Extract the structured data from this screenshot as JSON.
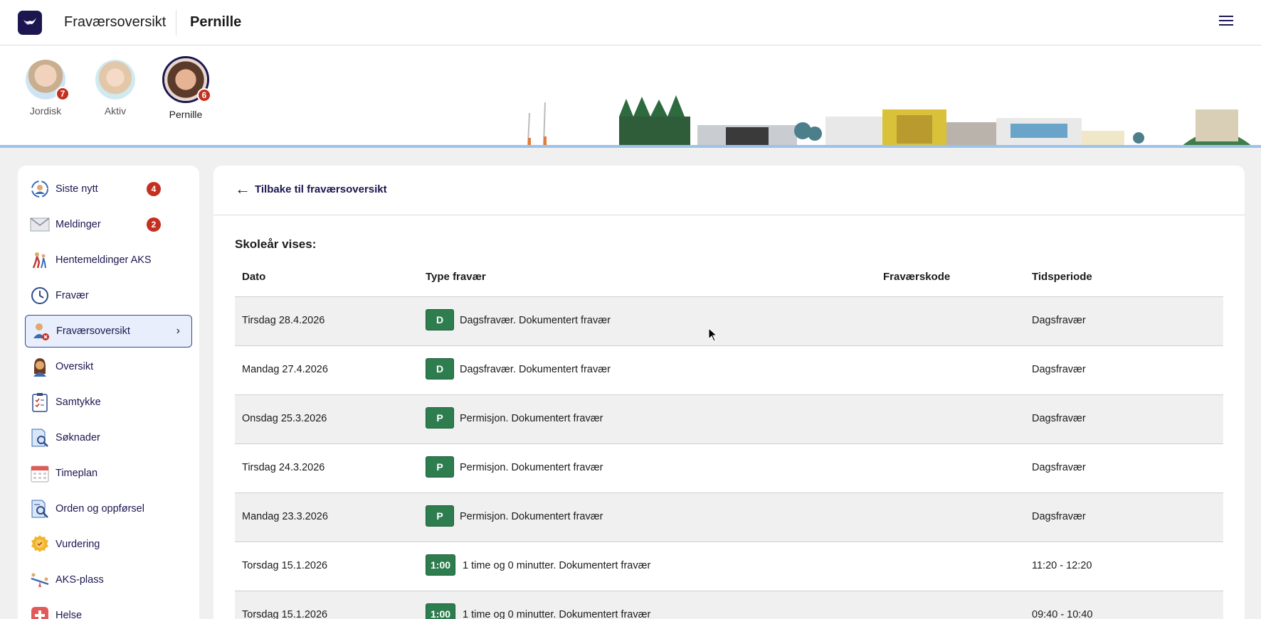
{
  "header": {
    "title": "Fraværsoversikt",
    "child_name": "Pernille"
  },
  "children": [
    {
      "name": "Jordisk",
      "badge": "7",
      "selected": false
    },
    {
      "name": "Aktiv",
      "badge": "",
      "selected": false
    },
    {
      "name": "Pernille",
      "badge": "6",
      "selected": true
    }
  ],
  "sidebar": {
    "items": [
      {
        "label": "Siste nytt",
        "count": "4",
        "icon": "news-icon"
      },
      {
        "label": "Meldinger",
        "count": "2",
        "icon": "envelope-icon"
      },
      {
        "label": "Hentemeldinger AKS",
        "count": "",
        "icon": "pickup-icon"
      },
      {
        "label": "Fravær",
        "count": "",
        "icon": "clock-icon"
      },
      {
        "label": "Fraværsoversikt",
        "count": "",
        "icon": "absence-overview-icon",
        "active": true
      },
      {
        "label": "Oversikt",
        "count": "",
        "icon": "overview-icon"
      },
      {
        "label": "Samtykke",
        "count": "",
        "icon": "clipboard-icon"
      },
      {
        "label": "Søknader",
        "count": "",
        "icon": "application-search-icon"
      },
      {
        "label": "Timeplan",
        "count": "",
        "icon": "calendar-icon"
      },
      {
        "label": "Orden og oppførsel",
        "count": "",
        "icon": "conduct-icon"
      },
      {
        "label": "Vurdering",
        "count": "",
        "icon": "medal-icon"
      },
      {
        "label": "AKS-plass",
        "count": "",
        "icon": "seesaw-icon"
      },
      {
        "label": "Helse",
        "count": "",
        "icon": "health-icon"
      }
    ]
  },
  "main": {
    "back_label": "Tilbake til fraværsoversikt",
    "school_year_label": "Skoleår vises:",
    "columns": [
      "Dato",
      "Type fravær",
      "Fraværskode",
      "Tidsperiode"
    ],
    "rows": [
      {
        "date": "Tirsdag 28.4.2026",
        "code": "D",
        "type": "Dagsfravær. Dokumentert fravær",
        "absence_code": "",
        "period": "Dagsfravær"
      },
      {
        "date": "Mandag 27.4.2026",
        "code": "D",
        "type": "Dagsfravær. Dokumentert fravær",
        "absence_code": "",
        "period": "Dagsfravær"
      },
      {
        "date": "Onsdag 25.3.2026",
        "code": "P",
        "type": "Permisjon. Dokumentert fravær",
        "absence_code": "",
        "period": "Dagsfravær"
      },
      {
        "date": "Tirsdag 24.3.2026",
        "code": "P",
        "type": "Permisjon. Dokumentert fravær",
        "absence_code": "",
        "period": "Dagsfravær"
      },
      {
        "date": "Mandag 23.3.2026",
        "code": "P",
        "type": "Permisjon. Dokumentert fravær",
        "absence_code": "",
        "period": "Dagsfravær"
      },
      {
        "date": "Torsdag 15.1.2026",
        "code": "1:00",
        "type": "1 time og 0 minutter. Dokumentert fravær",
        "absence_code": "",
        "period": "11:20 - 12:20"
      },
      {
        "date": "Torsdag 15.1.2026",
        "code": "1:00",
        "type": "1 time og 0 minutter. Dokumentert fravær",
        "absence_code": "",
        "period": "09:40 - 10:40"
      }
    ]
  },
  "colors": {
    "brand": "#1b1650",
    "code_green": "#2e7d4f",
    "badge_red": "#c4301f",
    "active_bg": "#e8eefb"
  }
}
